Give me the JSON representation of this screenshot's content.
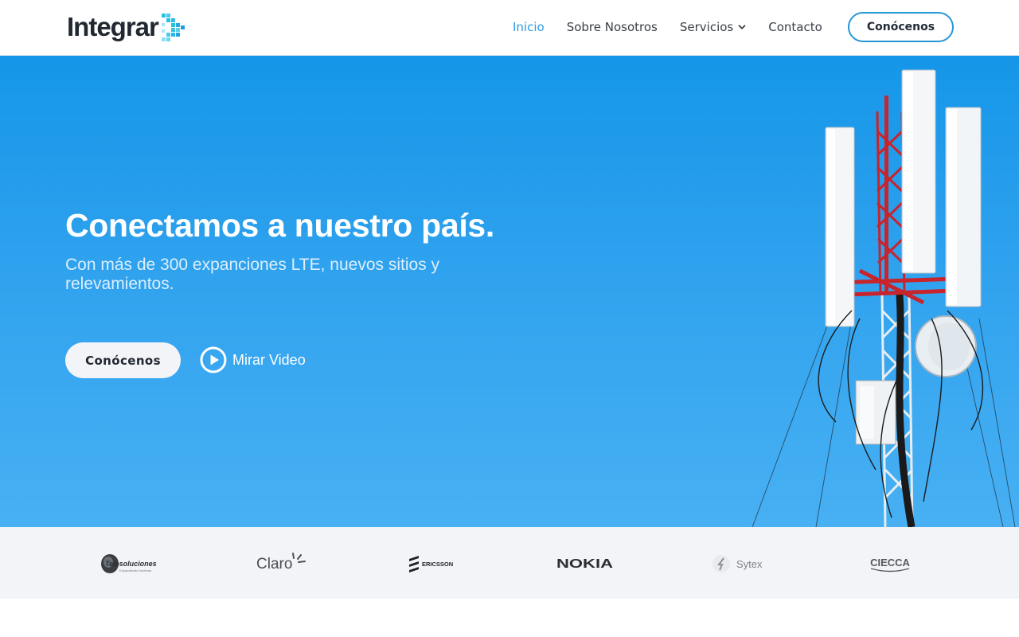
{
  "header": {
    "brand": "Integrar",
    "nav": [
      {
        "label": "Inicio",
        "active": true
      },
      {
        "label": "Sobre Nosotros",
        "active": false
      },
      {
        "label": "Servicios",
        "active": false,
        "has_dropdown": true
      },
      {
        "label": "Contacto",
        "active": false
      }
    ],
    "cta_label": "Conócenos"
  },
  "hero": {
    "title": "Conectamos a nuestro país.",
    "subtitle": "Con más de 300 expanciones LTE, nuevos sitios y relevamientos.",
    "primary_button": "Conócenos",
    "video_link": "Mirar Video"
  },
  "partners": [
    {
      "name": "Telesoluciones",
      "tagline": "Expandiendo fronteras"
    },
    {
      "name": "Claro"
    },
    {
      "name": "ERICSSON"
    },
    {
      "name": "NOKIA"
    },
    {
      "name": "Sytex"
    },
    {
      "name": "CIECCA"
    }
  ],
  "colors": {
    "accent": "#2596d6",
    "nav_active": "#2e9be0",
    "hero_top": "#1596e8",
    "hero_bottom": "#48b0f3",
    "logos_bg": "#f3f4f8",
    "tower_red": "#c8242c"
  },
  "icons": {
    "logo_mark": "pixel-arrow-icon",
    "dropdown": "chevron-down-icon",
    "video": "play-circle-icon"
  }
}
